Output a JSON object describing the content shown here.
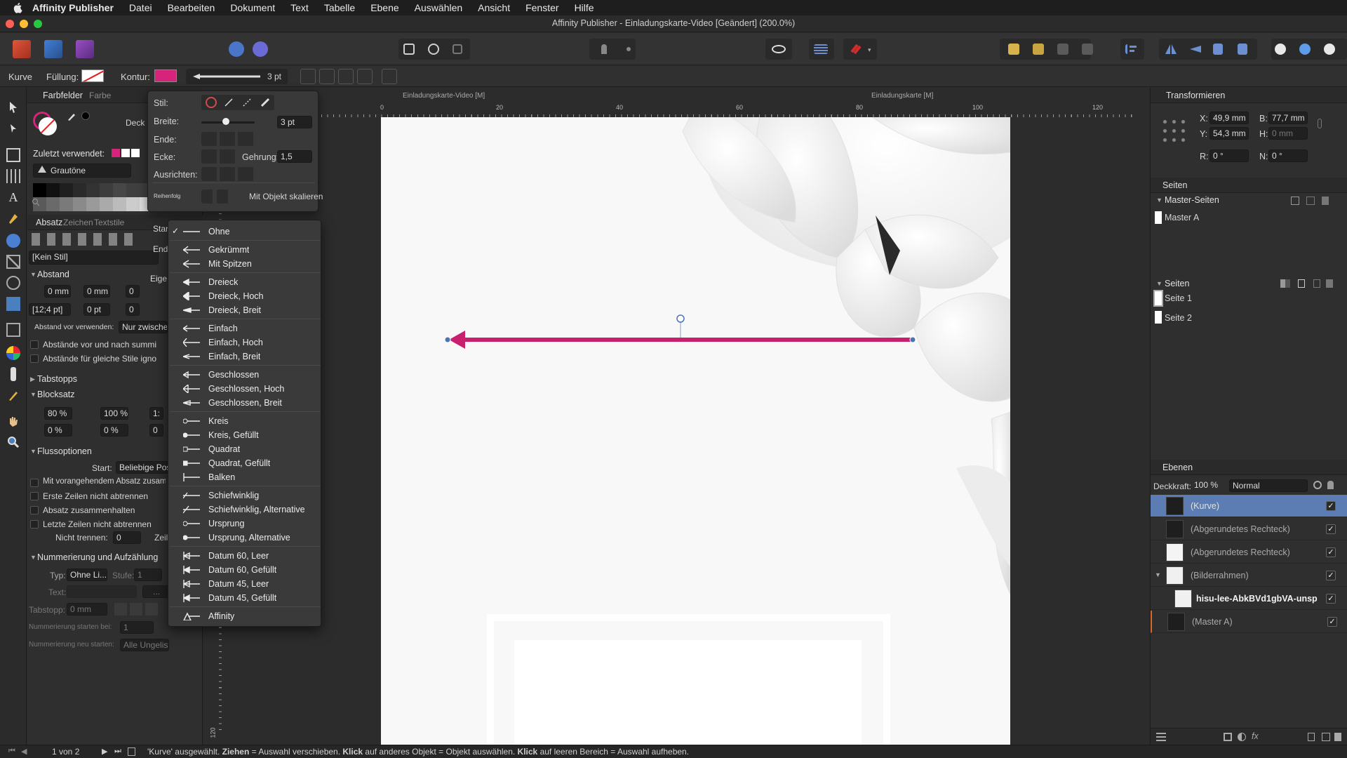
{
  "menubar": {
    "app_name": "Affinity Publisher",
    "items": [
      "Datei",
      "Bearbeiten",
      "Dokument",
      "Text",
      "Tabelle",
      "Ebene",
      "Auswählen",
      "Ansicht",
      "Fenster",
      "Hilfe"
    ]
  },
  "window": {
    "title": "Affinity Publisher - Einladungskarte-Video [Geändert] (200.0%)"
  },
  "context_toolbar": {
    "tool_label": "Kurve",
    "fill_label": "Füllung:",
    "stroke_label": "Kontur:",
    "stroke_color": "#d6247a",
    "stroke_width": "3 pt"
  },
  "left_panel": {
    "tabs": [
      "Farbfelder",
      "Farbe"
    ],
    "opacity_label": "Deck",
    "recent_label": "Zuletzt verwendet:",
    "palette_name": "Grautöne",
    "text_tabs": [
      "Absatz",
      "Zeichen",
      "Textstile"
    ],
    "style_value": "[Kein Stil]",
    "spacing_header": "Abstand",
    "space_before": "0 mm",
    "space_after": "0 mm",
    "space_third": "0",
    "leading": "[12;4 pt]",
    "leading_extra": "0 pt",
    "leading_third": "0",
    "apply_spacing_label": "Abstand vor verwenden:",
    "apply_spacing_value": "Nur zwische",
    "chk_spacing_1": "Abstände vor und nach summi",
    "chk_spacing_2": "Abstände für gleiche Stile igno",
    "tabstops_header": "Tabstopps",
    "justification_header": "Blocksatz",
    "just_word_min": "80 %",
    "just_word_desired": "100 %",
    "just_word_max": "1:",
    "just_letter_min": "0 %",
    "just_letter_desired": "0 %",
    "just_letter_max": "0",
    "flow_header": "Flussoptionen",
    "flow_start_label": "Start:",
    "flow_start_value": "Beliebige Pos",
    "flow_checks": [
      "Mit vorangehendem Absatz zusamn",
      "Erste Zeilen nicht abtrennen",
      "Absatz zusammenhalten",
      "Letzte Zeilen nicht abtrennen"
    ],
    "no_break_label": "Nicht trennen:",
    "no_break_value": "0",
    "no_break_unit": "Zeil",
    "numbering_header": "Nummerierung und Aufzählung",
    "type_label": "Typ:",
    "type_value": "Ohne Li...",
    "level_label": "Stufe:",
    "level_value": "1",
    "text_label": "Text:",
    "text_more": "...",
    "tabstop_label": "Tabstopp:",
    "tabstop_value": "0 mm",
    "num_start_label": "Nummerierung starten bei:",
    "num_start_value": "1",
    "num_restart_label": "Nummerierung neu starten:",
    "num_restart_value": "Alle Ungelist..."
  },
  "stroke_popup": {
    "style_label": "Stil:",
    "width_label": "Breite:",
    "width_value": "3 pt",
    "end_label": "Ende:",
    "corner_label": "Ecke:",
    "miter_label": "Gehrung:",
    "miter_value": "1,5",
    "align_label": "Ausrichten:",
    "order_label": "Reihenfolg",
    "scale_label": "Mit Objekt skalieren",
    "start_label": "Start",
    "end2_label": "End",
    "props_label": "Eige"
  },
  "arrowhead_menu": {
    "checked": "Ohne",
    "groups": [
      [
        {
          "label": "Ohne",
          "icon": "none"
        }
      ],
      [
        {
          "label": "Gekrümmt",
          "icon": "curved"
        },
        {
          "label": "Mit Spitzen",
          "icon": "spikes"
        }
      ],
      [
        {
          "label": "Dreieck",
          "icon": "tri"
        },
        {
          "label": "Dreieck, Hoch",
          "icon": "tri-tall"
        },
        {
          "label": "Dreieck, Breit",
          "icon": "tri-wide"
        }
      ],
      [
        {
          "label": "Einfach",
          "icon": "simple"
        },
        {
          "label": "Einfach, Hoch",
          "icon": "simple-tall"
        },
        {
          "label": "Einfach, Breit",
          "icon": "simple-wide"
        }
      ],
      [
        {
          "label": "Geschlossen",
          "icon": "closed"
        },
        {
          "label": "Geschlossen, Hoch",
          "icon": "closed-tall"
        },
        {
          "label": "Geschlossen, Breit",
          "icon": "closed-wide"
        }
      ],
      [
        {
          "label": "Kreis",
          "icon": "circle"
        },
        {
          "label": "Kreis, Gefüllt",
          "icon": "circle-filled"
        },
        {
          "label": "Quadrat",
          "icon": "square"
        },
        {
          "label": "Quadrat, Gefüllt",
          "icon": "square-filled"
        },
        {
          "label": "Balken",
          "icon": "bar"
        }
      ],
      [
        {
          "label": "Schiefwinklig",
          "icon": "oblique"
        },
        {
          "label": "Schiefwinklig, Alternative",
          "icon": "oblique-alt"
        },
        {
          "label": "Ursprung",
          "icon": "origin"
        },
        {
          "label": "Ursprung, Alternative",
          "icon": "origin-alt"
        }
      ],
      [
        {
          "label": "Datum 60, Leer",
          "icon": "datum-empty"
        },
        {
          "label": "Datum 60, Gefüllt",
          "icon": "datum-filled"
        },
        {
          "label": "Datum 45, Leer",
          "icon": "datum-empty"
        },
        {
          "label": "Datum 45, Gefüllt",
          "icon": "datum-filled"
        }
      ],
      [
        {
          "label": "Affinity",
          "icon": "affinity"
        }
      ]
    ]
  },
  "canvas": {
    "spread_labels": [
      "Einladungskarte-Video [M]",
      "Einladungskarte [M]"
    ],
    "ruler_h": [
      "0",
      "20",
      "40",
      "60",
      "80",
      "100",
      "120"
    ],
    "ruler_v_label": "120",
    "arrow_color": "#c8206f"
  },
  "right_panel": {
    "transform_header": "Transformieren",
    "x_label": "X:",
    "x_value": "49,9 mm",
    "y_label": "Y:",
    "y_value": "54,3 mm",
    "b_label": "B:",
    "b_value": "77,7 mm",
    "h_label": "H:",
    "h_value": "0 mm",
    "r_label": "R:",
    "r_value": "0 °",
    "n_label": "N:",
    "n_value": "0 °",
    "pages_header": "Seiten",
    "master_header": "Master-Seiten",
    "master_items": [
      "Master A"
    ],
    "pages_sub_header": "Seiten",
    "page_items": [
      "Seite 1",
      "Seite 2"
    ],
    "layers_header": "Ebenen",
    "opacity_label": "Deckkraft:",
    "opacity_value": "100 %",
    "blend_mode": "Normal",
    "layers": [
      "(Kurve)",
      "(Abgerundetes Rechteck)",
      "(Abgerundetes Rechteck)",
      "(Bilderrahmen)",
      "hisu-lee-AbkBVd1gbVA-unsp",
      "(Master A)"
    ]
  },
  "status": {
    "page_indicator": "1 von 2",
    "message_parts": [
      "'Kurve' ausgewählt. ",
      "Ziehen",
      " = Auswahl verschieben. ",
      "Klick",
      " auf anderes Objekt = Objekt auswählen. ",
      "Klick",
      " auf leeren Bereich = Auswahl aufheben."
    ]
  },
  "colors": {
    "accent": "#5a7fb8",
    "stroke": "#d6247a",
    "selected_layer": "#5b7db3"
  }
}
